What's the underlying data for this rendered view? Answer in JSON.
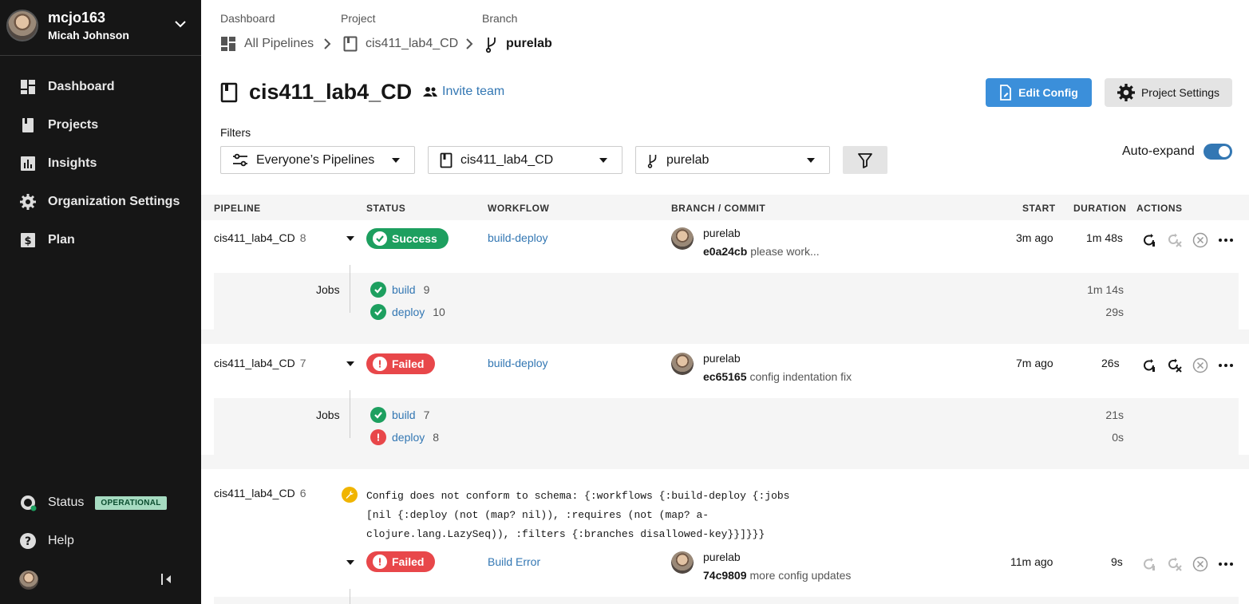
{
  "user": {
    "username": "mcjo163",
    "full_name": "Micah Johnson"
  },
  "nav": [
    {
      "label": "Dashboard"
    },
    {
      "label": "Projects"
    },
    {
      "label": "Insights"
    },
    {
      "label": "Organization Settings"
    },
    {
      "label": "Plan"
    }
  ],
  "footer": {
    "status_label": "Status",
    "status_badge": "OPERATIONAL",
    "help_label": "Help"
  },
  "breadcrumb": {
    "dashboard_label": "Dashboard",
    "project_label": "Project",
    "branch_label": "Branch",
    "dashboard_value": "All Pipelines",
    "project_value": "cis411_lab4_CD",
    "branch_value": "purelab"
  },
  "project": {
    "title": "cis411_lab4_CD",
    "invite_label": "Invite team",
    "edit_config": "Edit Config",
    "project_settings": "Project Settings"
  },
  "filters": {
    "label": "Filters",
    "pipelines": "Everyone’s Pipelines",
    "project": "cis411_lab4_CD",
    "branch": "purelab",
    "auto_expand_label": "Auto-expand",
    "auto_expand": true
  },
  "table": {
    "headers": {
      "pipeline": "PIPELINE",
      "status": "STATUS",
      "workflow": "WORKFLOW",
      "branch_commit": "BRANCH / COMMIT",
      "start": "START",
      "duration": "DURATION",
      "actions": "ACTIONS"
    },
    "rows": [
      {
        "project": "cis411_lab4_CD",
        "number": "8",
        "status": "Success",
        "workflow": "build-deploy",
        "branch": "purelab",
        "commit_hash": "e0a24cb",
        "commit_msg": "please work...",
        "start": "3m ago",
        "duration": "1m 48s",
        "jobs_label": "Jobs",
        "jobs": [
          {
            "name": "build",
            "number": "9",
            "duration": "1m 14s",
            "status": "success"
          },
          {
            "name": "deploy",
            "number": "10",
            "duration": "29s",
            "status": "success"
          }
        ]
      },
      {
        "project": "cis411_lab4_CD",
        "number": "7",
        "status": "Failed",
        "workflow": "build-deploy",
        "branch": "purelab",
        "commit_hash": "ec65165",
        "commit_msg": "config indentation fix",
        "start": "7m ago",
        "duration": "26s",
        "jobs_label": "Jobs",
        "jobs": [
          {
            "name": "build",
            "number": "7",
            "duration": "21s",
            "status": "success"
          },
          {
            "name": "deploy",
            "number": "8",
            "duration": "0s",
            "status": "failed"
          }
        ]
      },
      {
        "project": "cis411_lab4_CD",
        "number": "6",
        "error_lines": [
          "Config does not conform to schema: {:workflows {:build-deploy {:jobs",
          "[nil {:deploy (not (map? nil)), :requires (not (map? a-",
          "clojure.lang.LazySeq)), :filters {:branches disallowed-key}}]}}}"
        ],
        "status": "Failed",
        "workflow": "Build Error",
        "branch": "purelab",
        "commit_hash": "74c9809",
        "commit_msg": "more config updates",
        "start": "11m ago",
        "duration": "9s"
      }
    ]
  },
  "colors": {
    "success": "#1d9f5f",
    "failed": "#e8474a",
    "link": "#3377b3",
    "primary": "#3b8fda",
    "warning": "#f0b400"
  }
}
